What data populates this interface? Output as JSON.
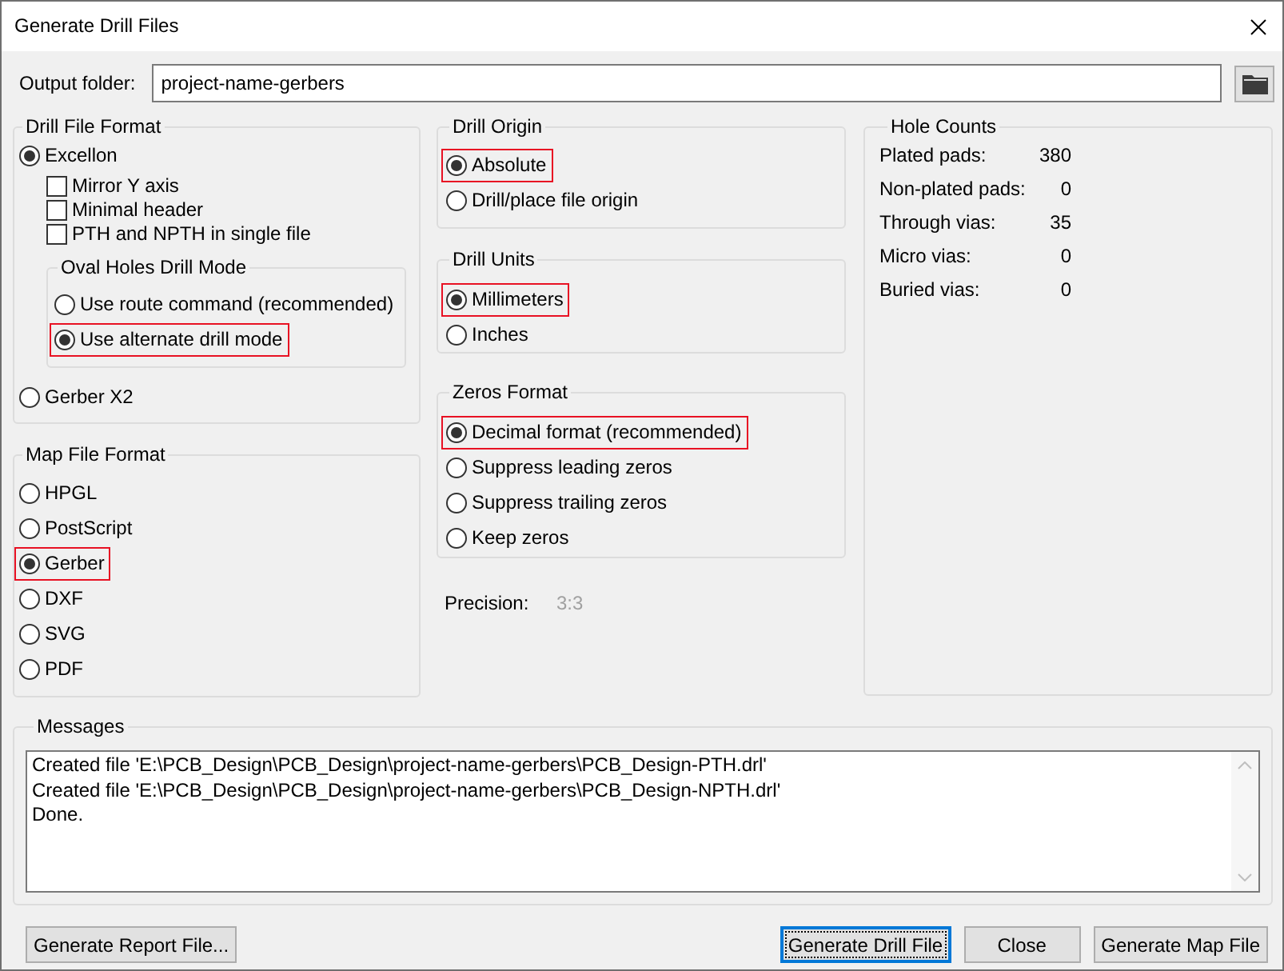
{
  "window": {
    "title": "Generate Drill Files"
  },
  "output_folder": {
    "label": "Output folder:",
    "value": "project-name-gerbers"
  },
  "drill_file_format": {
    "title": "Drill File Format",
    "formats": [
      {
        "label": "Excellon",
        "selected": true,
        "highlighted": false
      },
      {
        "label": "Gerber X2",
        "selected": false,
        "highlighted": false
      }
    ],
    "options": [
      {
        "label": "Mirror Y axis",
        "checked": false
      },
      {
        "label": "Minimal header",
        "checked": false
      },
      {
        "label": "PTH and NPTH in single file",
        "checked": false
      }
    ],
    "oval_holes_drill_mode": {
      "title": "Oval Holes Drill Mode",
      "options": [
        {
          "label": "Use route command (recommended)",
          "selected": false,
          "highlighted": false
        },
        {
          "label": "Use alternate drill mode",
          "selected": true,
          "highlighted": true
        }
      ]
    }
  },
  "map_file_format": {
    "title": "Map File Format",
    "options": [
      {
        "label": "HPGL",
        "selected": false,
        "highlighted": false
      },
      {
        "label": "PostScript",
        "selected": false,
        "highlighted": false
      },
      {
        "label": "Gerber",
        "selected": true,
        "highlighted": true
      },
      {
        "label": "DXF",
        "selected": false,
        "highlighted": false
      },
      {
        "label": "SVG",
        "selected": false,
        "highlighted": false
      },
      {
        "label": "PDF",
        "selected": false,
        "highlighted": false
      }
    ]
  },
  "drill_origin": {
    "title": "Drill Origin",
    "options": [
      {
        "label": "Absolute",
        "selected": true,
        "highlighted": true
      },
      {
        "label": "Drill/place file origin",
        "selected": false,
        "highlighted": false
      }
    ]
  },
  "drill_units": {
    "title": "Drill Units",
    "options": [
      {
        "label": "Millimeters",
        "selected": true,
        "highlighted": true
      },
      {
        "label": "Inches",
        "selected": false,
        "highlighted": false
      }
    ]
  },
  "zeros_format": {
    "title": "Zeros Format",
    "options": [
      {
        "label": "Decimal format (recommended)",
        "selected": true,
        "highlighted": true
      },
      {
        "label": "Suppress leading zeros",
        "selected": false,
        "highlighted": false
      },
      {
        "label": "Suppress trailing zeros",
        "selected": false,
        "highlighted": false
      },
      {
        "label": "Keep zeros",
        "selected": false,
        "highlighted": false
      }
    ]
  },
  "precision": {
    "label": "Precision:",
    "value": "3:3",
    "disabled": true
  },
  "hole_counts": {
    "title": "Hole Counts",
    "rows": [
      {
        "label": "Plated pads:",
        "value": "380"
      },
      {
        "label": "Non-plated pads:",
        "value": "0"
      },
      {
        "label": "Through vias:",
        "value": "35"
      },
      {
        "label": "Micro vias:",
        "value": "0"
      },
      {
        "label": "Buried vias:",
        "value": "0"
      }
    ]
  },
  "messages": {
    "title": "Messages",
    "lines": [
      "Created file 'E:\\PCB_Design\\PCB_Design\\project-name-gerbers\\PCB_Design-PTH.drl'",
      "Created file 'E:\\PCB_Design\\PCB_Design\\project-name-gerbers\\PCB_Design-NPTH.drl'",
      "Done."
    ]
  },
  "buttons": {
    "left": [
      {
        "label": "Generate Report File...",
        "focused": false
      }
    ],
    "right": [
      {
        "label": "Generate Drill File",
        "focused": true
      },
      {
        "label": "Close",
        "focused": false
      },
      {
        "label": "Generate Map File",
        "focused": false
      }
    ]
  }
}
